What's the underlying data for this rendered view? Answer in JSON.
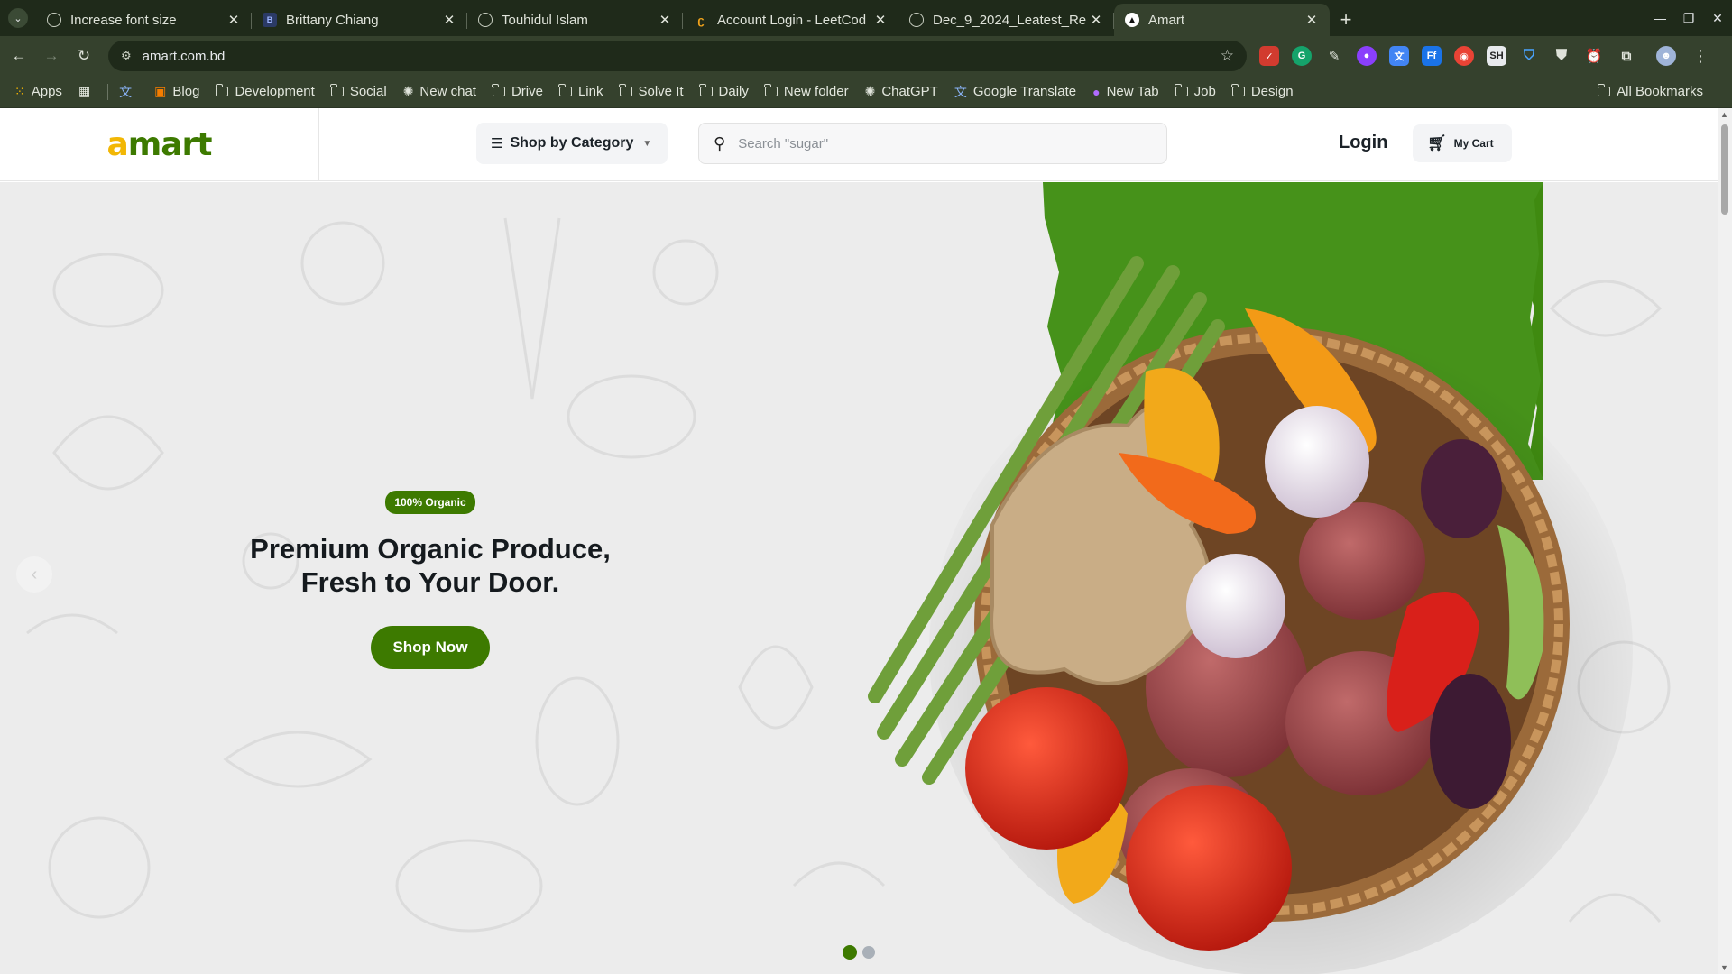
{
  "browser": {
    "tabs": [
      {
        "title": "Increase font size",
        "icon": "globe-icon",
        "active": false
      },
      {
        "title": "Brittany Chiang",
        "icon": "b-icon",
        "active": false
      },
      {
        "title": "Touhidul Islam",
        "icon": "globe-icon",
        "active": false
      },
      {
        "title": "Account Login - LeetCod",
        "icon": "leetcode-icon",
        "active": false
      },
      {
        "title": "Dec_9_2024_Leatest_Re",
        "icon": "globe-icon",
        "active": false
      },
      {
        "title": "Amart",
        "icon": "amart-icon",
        "active": true
      }
    ],
    "url": "amart.com.bd",
    "bookmarks": [
      {
        "label": "Apps",
        "icon": "apps-grid-icon"
      },
      {
        "label": "Blog",
        "icon": "blogger-icon"
      },
      {
        "label": "Development",
        "icon": "folder-icon"
      },
      {
        "label": "Social",
        "icon": "folder-icon"
      },
      {
        "label": "New chat",
        "icon": "chatgpt-icon"
      },
      {
        "label": "Drive",
        "icon": "folder-icon"
      },
      {
        "label": "Link",
        "icon": "folder-icon"
      },
      {
        "label": "Solve It",
        "icon": "folder-icon"
      },
      {
        "label": "Daily",
        "icon": "folder-icon"
      },
      {
        "label": "New folder",
        "icon": "folder-icon"
      },
      {
        "label": "ChatGPT",
        "icon": "chatgpt-icon"
      },
      {
        "label": "Google Translate",
        "icon": "translate-icon"
      },
      {
        "label": "New Tab",
        "icon": "newtab-icon"
      },
      {
        "label": "Job",
        "icon": "folder-icon"
      },
      {
        "label": "Design",
        "icon": "folder-icon"
      }
    ],
    "all_bookmarks": "All Bookmarks",
    "theme_color": "#35412d"
  },
  "site": {
    "logo_a": "a",
    "logo_rest": "mart",
    "brand_green": "#3d7a00",
    "brand_yellow": "#f2b705",
    "category_button": "Shop by Category",
    "search_placeholder": "Search \"sugar\"",
    "login": "Login",
    "cart": "My Cart"
  },
  "hero": {
    "badge": "100% Organic",
    "headline_line1": "Premium Organic Produce,",
    "headline_line2": "Fresh to Your Door.",
    "cta": "Shop Now",
    "slides_total": 2,
    "active_slide": 1
  }
}
